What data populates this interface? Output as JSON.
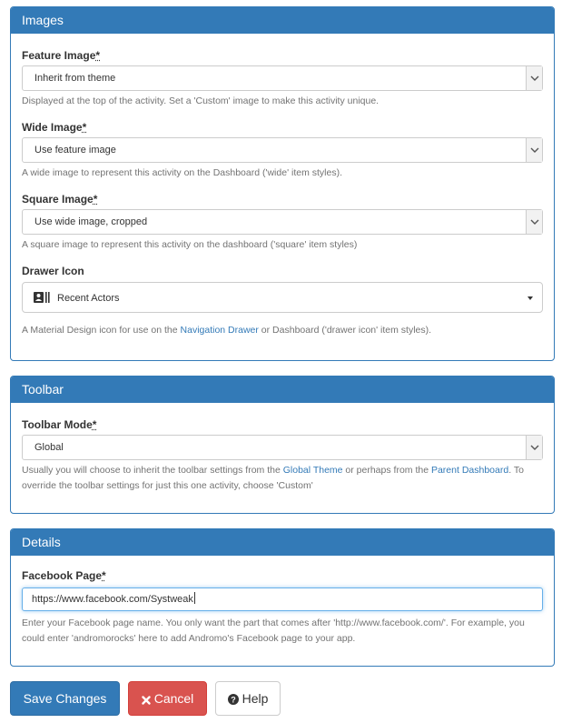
{
  "images_panel": {
    "title": "Images",
    "feature_image": {
      "label": "Feature Image",
      "required_mark": "*",
      "value": "Inherit from theme",
      "help": "Displayed at the top of the activity. Set a 'Custom' image to make this activity unique."
    },
    "wide_image": {
      "label": "Wide Image",
      "required_mark": "*",
      "value": "Use feature image",
      "help": "A wide image to represent this activity on the Dashboard ('wide' item styles)."
    },
    "square_image": {
      "label": "Square Image",
      "required_mark": "*",
      "value": "Use wide image, cropped",
      "help": "A square image to represent this activity on the dashboard ('square' item styles)"
    },
    "drawer_icon": {
      "label": "Drawer Icon",
      "value": "Recent Actors",
      "icon": "recent-actors-icon",
      "help_before": "A Material Design icon for use on the ",
      "help_link": "Navigation Drawer",
      "help_after": " or Dashboard ('drawer icon' item styles)."
    }
  },
  "toolbar_panel": {
    "title": "Toolbar",
    "toolbar_mode": {
      "label": "Toolbar Mode",
      "required_mark": "*",
      "value": "Global",
      "help_part1": "Usually you will choose to inherit the toolbar settings from the ",
      "help_link1": "Global Theme",
      "help_part2": " or perhaps from the ",
      "help_link2": "Parent Dashboard",
      "help_part3": ". To override the toolbar settings for just this one activity, choose 'Custom'"
    }
  },
  "details_panel": {
    "title": "Details",
    "facebook_page": {
      "label": "Facebook Page",
      "required_mark": "*",
      "value": "https://www.facebook.com/Systweak",
      "help": "Enter your Facebook page name. You only want the part that comes after 'http://www.facebook.com/'. For example, you could enter 'andromorocks' here to add Andromo's Facebook page to your app."
    }
  },
  "buttons": {
    "save": "Save Changes",
    "cancel": "Cancel",
    "help": "Help"
  },
  "colors": {
    "primary": "#337ab7",
    "danger": "#d9534f",
    "link": "#337ab7"
  }
}
